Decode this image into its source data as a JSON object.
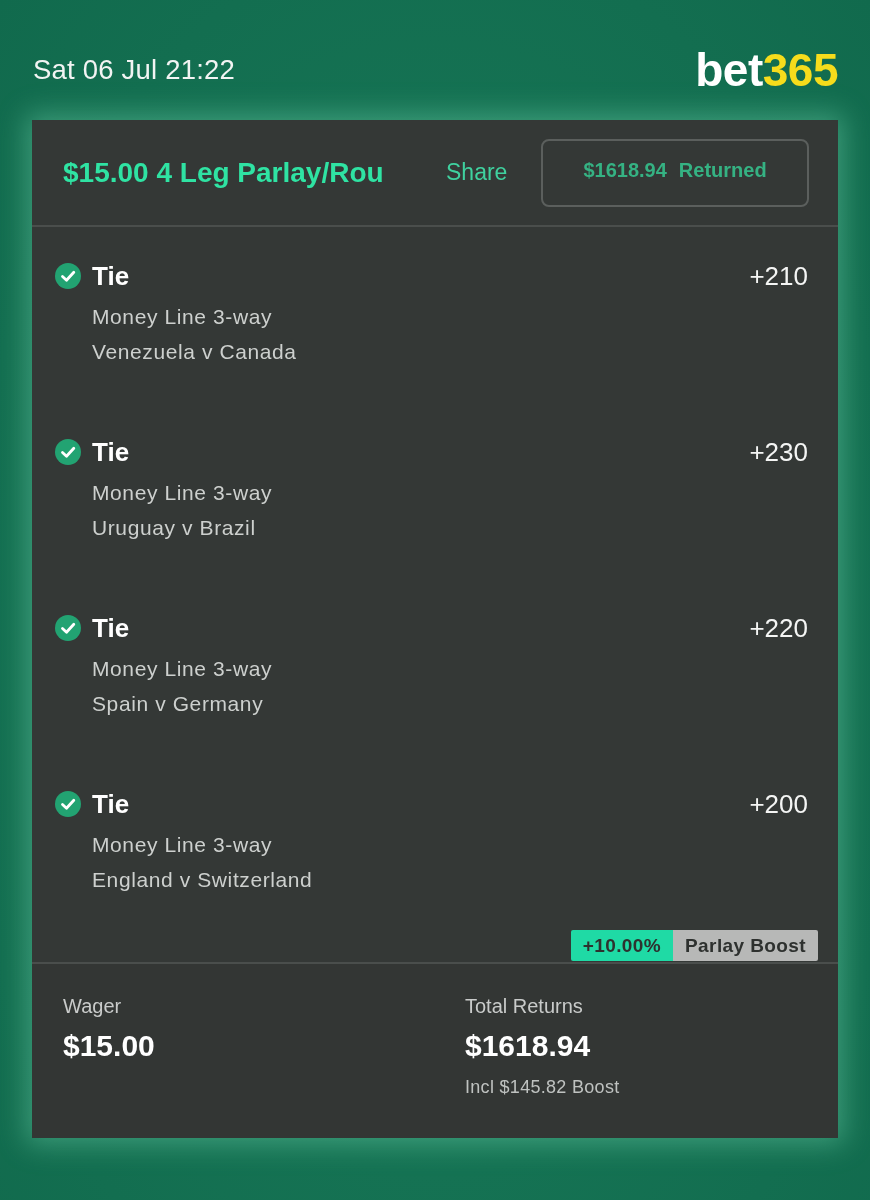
{
  "status_bar": {
    "time": "Sat 06 Jul 21:22"
  },
  "logo": {
    "word": "bet",
    "number": "365"
  },
  "bet_header": {
    "title": "$15.00 4 Leg Parlay/Rou",
    "share": "Share",
    "returned": {
      "amount": "$1618.94",
      "label": "Returned"
    }
  },
  "legs": [
    {
      "won": true,
      "selection": "Tie",
      "odds": "+210",
      "market": "Money Line 3-way",
      "match": "Venezuela v Canada"
    },
    {
      "won": true,
      "selection": "Tie",
      "odds": "+230",
      "market": "Money Line 3-way",
      "match": "Uruguay v Brazil"
    },
    {
      "won": true,
      "selection": "Tie",
      "odds": "+220",
      "market": "Money Line 3-way",
      "match": "Spain v Germany"
    },
    {
      "won": true,
      "selection": "Tie",
      "odds": "+200",
      "market": "Money Line 3-way",
      "match": "England v Switzerland"
    }
  ],
  "boost_tag": {
    "percent": "+10.00%",
    "label": "Parlay Boost"
  },
  "summary": {
    "wager_label": "Wager",
    "wager": "$15.00",
    "returns_label": "Total Returns",
    "returns": "$1618.94",
    "boost_note": "Incl $145.82 Boost"
  }
}
